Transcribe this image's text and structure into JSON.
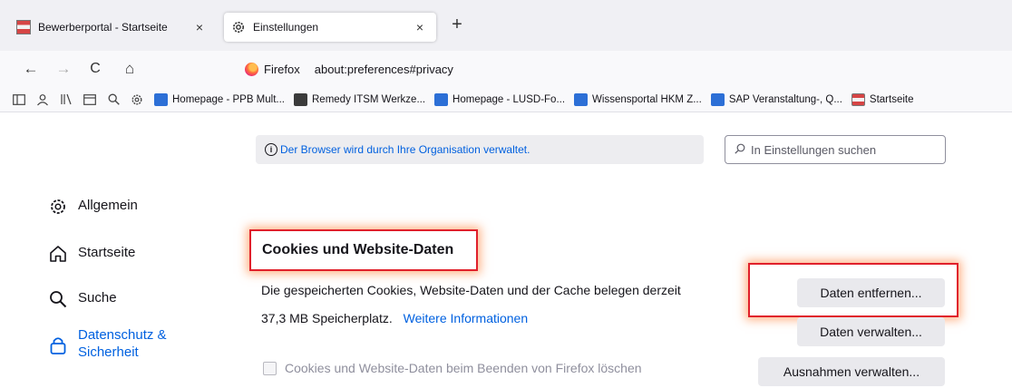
{
  "tabs": [
    {
      "title": "Bewerberportal - Startseite",
      "close": "×"
    },
    {
      "title": "Einstellungen",
      "close": "×"
    }
  ],
  "new_tab": "+",
  "navbar": {
    "back": "←",
    "forward": "→",
    "reload": "C",
    "home": "⌂",
    "identity": "Firefox",
    "url": "about:preferences#privacy"
  },
  "bookmarks": [
    {
      "label": "Homepage - PPB Mult...",
      "icon": "sharepoint-icon"
    },
    {
      "label": "Remedy ITSM Werkze...",
      "icon": "remedy-icon"
    },
    {
      "label": "Homepage - LUSD-Fo...",
      "icon": "sharepoint-icon"
    },
    {
      "label": "Wissensportal HKM Z...",
      "icon": "sharepoint-icon"
    },
    {
      "label": "SAP Veranstaltung-, Q...",
      "icon": "sharepoint-icon"
    },
    {
      "label": "Startseite",
      "icon": "portal-icon"
    }
  ],
  "policy_notice": "Der Browser wird durch Ihre Organisation verwaltet.",
  "search": {
    "placeholder": "In Einstellungen suchen",
    "value": ""
  },
  "categories": [
    {
      "label": "Allgemein",
      "icon": "gear-icon"
    },
    {
      "label": "Startseite",
      "icon": "home-icon"
    },
    {
      "label": "Suche",
      "icon": "search-icon"
    },
    {
      "label": "Datenschutz & Sicherheit",
      "icon": "lock-icon",
      "selected": true
    }
  ],
  "cookies_section": {
    "title": "Cookies und Website-Daten",
    "description_line1": "Die gespeicherten Cookies, Website-Daten und der Cache belegen derzeit",
    "description_line2": "37,3 MB Speicherplatz.",
    "learn_more": "Weitere Informationen",
    "clear_button": "Daten entfernen...",
    "manage_button": "Daten verwalten...",
    "exceptions_button": "Ausnahmen verwalten...",
    "delete_on_close_label": "Cookies und Website-Daten beim Beenden von Firefox löschen",
    "delete_on_close_checked": false
  },
  "colors": {
    "accent": "#0061e0",
    "highlight": "#e0202b"
  }
}
